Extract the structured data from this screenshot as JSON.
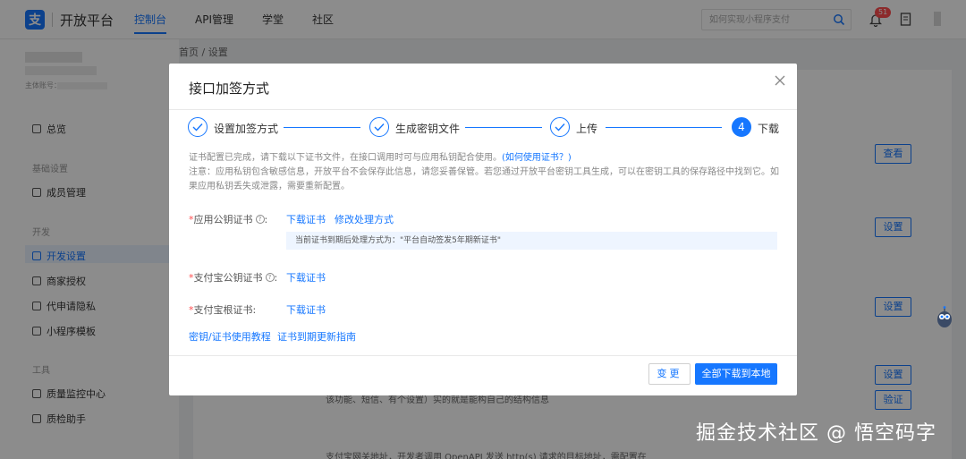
{
  "topbar": {
    "logo_mark": "支",
    "logo_text": "开放平台",
    "nav": [
      "控制台",
      "API管理",
      "学堂",
      "社区"
    ],
    "search_placeholder": "如何实现小程序支付",
    "notification_count": "51"
  },
  "sidebar": {
    "account_label": "主体账号：",
    "groups": [
      "基础设置",
      "开发",
      "工具"
    ],
    "items": {
      "overview": "总览",
      "member": "成员管理",
      "dev_settings": "开发设置",
      "merchant_auth": "商家授权",
      "privacy": "代申请隐私",
      "miniapp_tpl": "小程序模板",
      "quality": "质量监控中心",
      "qa_helper": "质检助手"
    }
  },
  "breadcrumb": {
    "home": "首页",
    "sep": "/",
    "current": "设置"
  },
  "background": {
    "buttons": {
      "view": "查看",
      "setup": "设置",
      "verify": "验证"
    },
    "text1": "该功能、短信、有个设置）实的就是能构自己的结构信息",
    "text2": "支付宝网关地址，开发者调用 OpenAPI 发送 http(s) 请求的目标地址，需配置在"
  },
  "modal": {
    "title": "接口加签方式",
    "steps": [
      {
        "label": "设置加签方式",
        "state": "done"
      },
      {
        "label": "生成密钥文件",
        "state": "done"
      },
      {
        "label": "上传",
        "state": "done"
      },
      {
        "label": "下载",
        "state": "current",
        "number": "4"
      }
    ],
    "info_line1": "证书配置已完成，请下载以下证书文件，在接口调用时可与应用私钥配合使用。",
    "info_link": "(如何使用证书？)",
    "info_line2": "注意：应用私钥包含敏感信息，开放平台不会保存此信息，请您妥善保管。若您通过开放平台密钥工具生成，可以在密钥工具的保存路径中找到它。如果应用私钥丢失或泄露，需要重新配置。",
    "rows": {
      "app_cert_label": "应用公钥证书",
      "alipay_cert_label": "支付宝公钥证书",
      "root_cert_label": "支付宝根证书",
      "colon": ":"
    },
    "links": {
      "download_cert": "下载证书",
      "modify_handling": "修改处理方式",
      "tutorial": "密钥/证书使用教程",
      "renew_guide": "证书到期更新指南"
    },
    "notice": "当前证书到期后处理方式为：\"平台自动签发5年期新证书\"",
    "footer": {
      "change": "变更",
      "download_all": "全部下载到本地"
    }
  },
  "watermark": "掘金技术社区 @ 悟空码字",
  "colors": {
    "primary": "#1677ff",
    "required": "#ff4d4f",
    "notice_bg": "#eef5ff"
  }
}
